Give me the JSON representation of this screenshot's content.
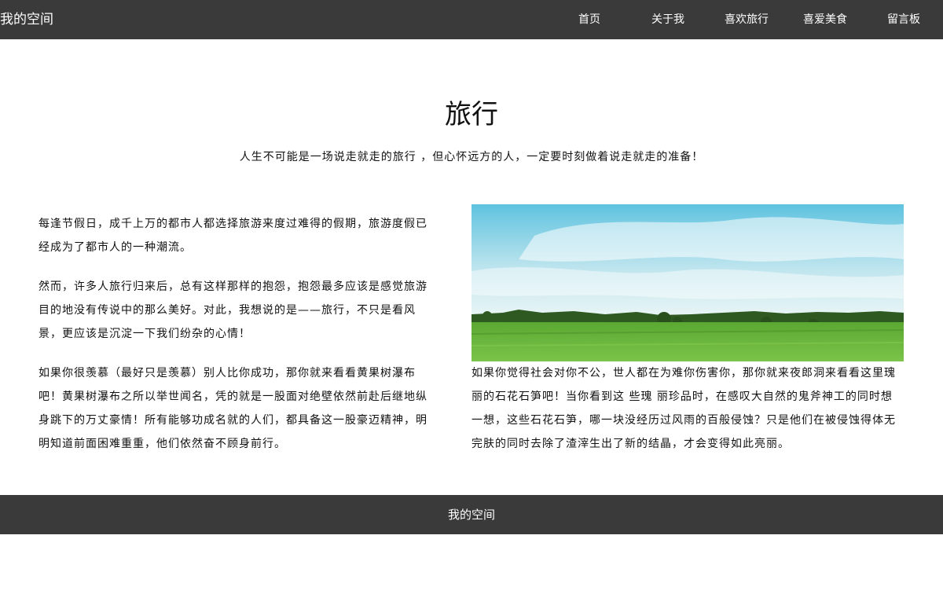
{
  "header": {
    "brand": "我的空间",
    "nav": [
      {
        "label": "首页"
      },
      {
        "label": "关于我"
      },
      {
        "label": "喜欢旅行"
      },
      {
        "label": "喜爱美食"
      },
      {
        "label": "留言板"
      }
    ]
  },
  "main": {
    "title": "旅行",
    "subtitle": "人生不可能是一场说走就走的旅行 ，但心怀远方的人，一定要时刻做着说走就走的准备！",
    "left_paragraphs": [
      "每逢节假日，成千上万的都市人都选择旅游来度过难得的假期，旅游度假已经成为了都市人的一种潮流。",
      "然而，许多人旅行归来后，总有这样那样的抱怨，抱怨最多应该是感觉旅游目的地没有传说中的那么美好。对此，我想说的是——旅行，不只是看风景，更应该是沉淀一下我们纷杂的心情！",
      "如果你很羡慕（最好只是羡慕）别人比你成功，那你就来看看黄果树瀑布吧！黄果树瀑布之所以举世闻名，凭的就是一股面对绝壁依然前赴后继地纵身跳下的万丈豪情！所有能够功成名就的人们，都具备这一股豪迈精神，明明知道前面困难重重，他们依然奋不顾身前行。"
    ],
    "image": {
      "icon": "landscape-photo",
      "colors": {
        "sky_top": "#5fc3df",
        "sky_bottom": "#eef7f6",
        "cloud": "#ffffff",
        "field": "#4f9a2c",
        "field_light": "#7cc44a",
        "trees": "#2e5a22"
      }
    },
    "right_paragraph": "如果你觉得社会对你不公，世人都在为难你伤害你，那你就来夜郎洞来看看这里瑰丽的石花石笋吧！当你看到这 些瑰 丽珍品时，在感叹大自然的鬼斧神工的同时想一想，这些石花石笋，哪一块没经历过风雨的百般侵蚀？只是他们在被侵蚀得体无完肤的同时去除了渣滓生出了新的结晶，才会变得如此亮丽。"
  },
  "footer": {
    "text": "我的空间"
  },
  "colors": {
    "bar": "#3a3a3a",
    "bar_text": "#ffffff",
    "body_text": "#111111"
  }
}
